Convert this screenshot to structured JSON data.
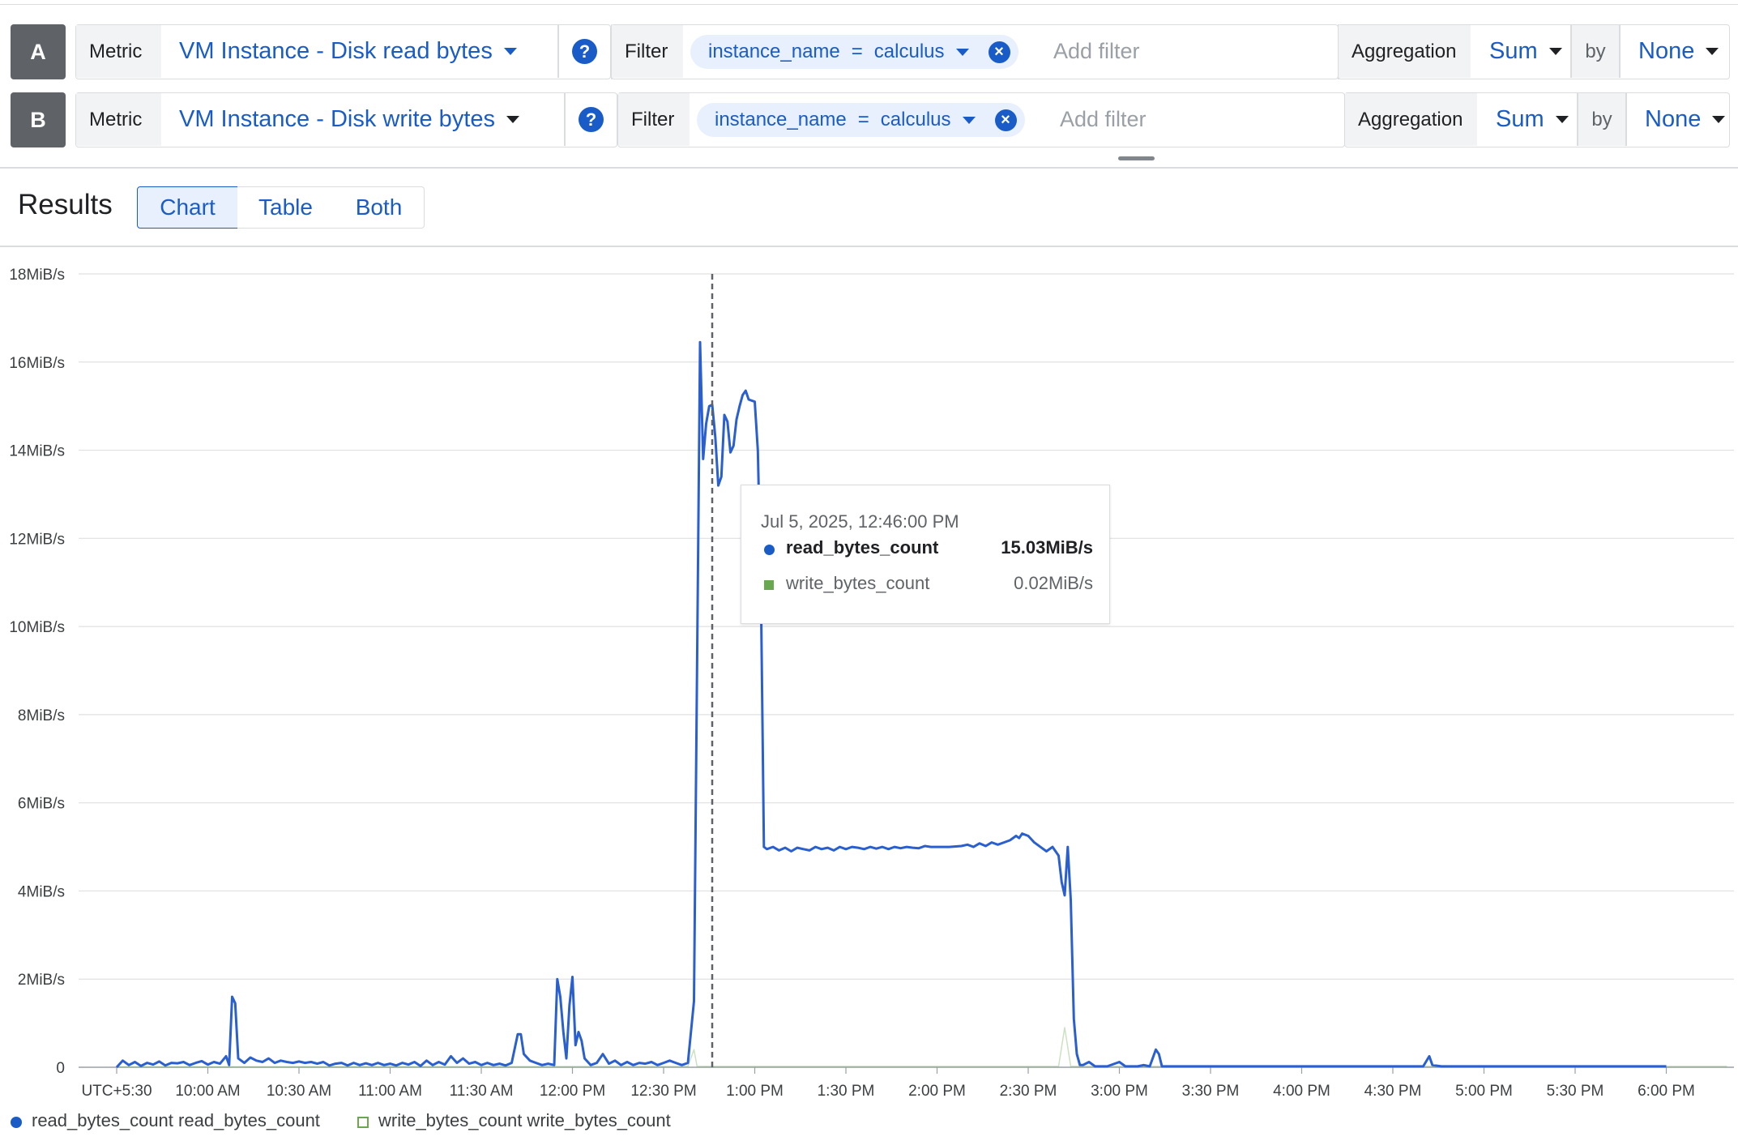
{
  "queries": [
    {
      "letter": "A",
      "metric_label": "Metric",
      "metric_value": "VM Instance - Disk read bytes",
      "help_icon": "?",
      "filter_label": "Filter",
      "filter_key": "instance_name",
      "filter_op": "=",
      "filter_value": "calculus",
      "filter_remove": "×",
      "add_filter_placeholder": "Add filter",
      "aggregation_label": "Aggregation",
      "aggregation_value": "Sum",
      "by_label": "by",
      "group_value": "None"
    },
    {
      "letter": "B",
      "metric_label": "Metric",
      "metric_value": "VM Instance - Disk write bytes",
      "help_icon": "?",
      "filter_label": "Filter",
      "filter_key": "instance_name",
      "filter_op": "=",
      "filter_value": "calculus",
      "filter_remove": "×",
      "add_filter_placeholder": "Add filter",
      "aggregation_label": "Aggregation",
      "aggregation_value": "Sum",
      "by_label": "by",
      "group_value": "None"
    }
  ],
  "results": {
    "title": "Results",
    "view_tabs": [
      "Chart",
      "Table",
      "Both"
    ],
    "active_tab": "Chart"
  },
  "tooltip": {
    "date": "Jul 5, 2025, 12:46:00 PM",
    "rows": [
      {
        "name": "read_bytes_count",
        "value": "15.03MiB/s"
      },
      {
        "name": "write_bytes_count",
        "value": "0.02MiB/s"
      }
    ]
  },
  "legend": [
    {
      "label": "read_bytes_count read_bytes_count"
    },
    {
      "label": "write_bytes_count write_bytes_count"
    }
  ],
  "colors": {
    "accent": "#1a5cc7",
    "read_series": "#2a5fcf",
    "write_series": "#6aa84f",
    "gridline": "#e0e0e0"
  },
  "chart_data": {
    "type": "line",
    "y_unit": "MiB/s",
    "ylim": [
      0,
      18
    ],
    "y_ticks": [
      "0",
      "2MiB/s",
      "4MiB/s",
      "6MiB/s",
      "8MiB/s",
      "10MiB/s",
      "12MiB/s",
      "14MiB/s",
      "16MiB/s",
      "18MiB/s"
    ],
    "x_ticks": [
      "UTC+5:30",
      "10:00 AM",
      "10:30 AM",
      "11:00 AM",
      "11:30 AM",
      "12:00 PM",
      "12:30 PM",
      "1:00 PM",
      "1:30 PM",
      "2:00 PM",
      "2:30 PM",
      "3:00 PM",
      "3:30 PM",
      "4:00 PM",
      "4:30 PM",
      "5:00 PM",
      "5:30 PM",
      "6:00 PM"
    ],
    "x_range": [
      "09:30",
      "18:20"
    ],
    "grid": true,
    "cursor_time": "12:46",
    "series": [
      {
        "name": "read_bytes_count",
        "points": [
          [
            "09:30",
            0.0
          ],
          [
            "09:32",
            0.15
          ],
          [
            "09:34",
            0.05
          ],
          [
            "09:36",
            0.12
          ],
          [
            "09:38",
            0.03
          ],
          [
            "09:40",
            0.1
          ],
          [
            "09:42",
            0.06
          ],
          [
            "09:44",
            0.13
          ],
          [
            "09:46",
            0.04
          ],
          [
            "09:48",
            0.1
          ],
          [
            "09:50",
            0.09
          ],
          [
            "09:52",
            0.12
          ],
          [
            "09:54",
            0.05
          ],
          [
            "09:56",
            0.1
          ],
          [
            "09:58",
            0.14
          ],
          [
            "10:00",
            0.06
          ],
          [
            "10:02",
            0.12
          ],
          [
            "10:04",
            0.08
          ],
          [
            "10:06",
            0.25
          ],
          [
            "10:07",
            0.05
          ],
          [
            "10:08",
            1.6
          ],
          [
            "10:09",
            1.45
          ],
          [
            "10:10",
            0.2
          ],
          [
            "10:12",
            0.1
          ],
          [
            "10:14",
            0.22
          ],
          [
            "10:16",
            0.15
          ],
          [
            "10:18",
            0.12
          ],
          [
            "10:20",
            0.2
          ],
          [
            "10:22",
            0.1
          ],
          [
            "10:24",
            0.15
          ],
          [
            "10:26",
            0.12
          ],
          [
            "10:28",
            0.1
          ],
          [
            "10:30",
            0.13
          ],
          [
            "10:32",
            0.1
          ],
          [
            "10:34",
            0.12
          ],
          [
            "10:36",
            0.08
          ],
          [
            "10:38",
            0.12
          ],
          [
            "10:40",
            0.04
          ],
          [
            "10:42",
            0.08
          ],
          [
            "10:44",
            0.1
          ],
          [
            "10:46",
            0.04
          ],
          [
            "10:48",
            0.1
          ],
          [
            "10:50",
            0.05
          ],
          [
            "10:52",
            0.09
          ],
          [
            "10:54",
            0.05
          ],
          [
            "10:56",
            0.1
          ],
          [
            "10:58",
            0.05
          ],
          [
            "11:00",
            0.08
          ],
          [
            "11:02",
            0.04
          ],
          [
            "11:04",
            0.1
          ],
          [
            "11:06",
            0.06
          ],
          [
            "11:08",
            0.12
          ],
          [
            "11:10",
            0.03
          ],
          [
            "11:12",
            0.15
          ],
          [
            "11:14",
            0.05
          ],
          [
            "11:16",
            0.12
          ],
          [
            "11:18",
            0.06
          ],
          [
            "11:20",
            0.25
          ],
          [
            "11:22",
            0.1
          ],
          [
            "11:24",
            0.2
          ],
          [
            "11:26",
            0.08
          ],
          [
            "11:28",
            0.12
          ],
          [
            "11:30",
            0.05
          ],
          [
            "11:32",
            0.1
          ],
          [
            "11:34",
            0.05
          ],
          [
            "11:36",
            0.08
          ],
          [
            "11:38",
            0.04
          ],
          [
            "11:40",
            0.1
          ],
          [
            "11:42",
            0.75
          ],
          [
            "11:43",
            0.75
          ],
          [
            "11:44",
            0.3
          ],
          [
            "11:46",
            0.15
          ],
          [
            "11:48",
            0.1
          ],
          [
            "11:50",
            0.05
          ],
          [
            "11:52",
            0.08
          ],
          [
            "11:54",
            0.05
          ],
          [
            "11:55",
            2.0
          ],
          [
            "11:56",
            1.6
          ],
          [
            "11:57",
            0.8
          ],
          [
            "11:58",
            0.2
          ],
          [
            "11:59",
            1.4
          ],
          [
            "12:00",
            2.05
          ],
          [
            "12:01",
            0.5
          ],
          [
            "12:02",
            0.8
          ],
          [
            "12:03",
            0.6
          ],
          [
            "12:04",
            0.2
          ],
          [
            "12:06",
            0.05
          ],
          [
            "12:08",
            0.1
          ],
          [
            "12:10",
            0.3
          ],
          [
            "12:12",
            0.08
          ],
          [
            "12:14",
            0.15
          ],
          [
            "12:16",
            0.05
          ],
          [
            "12:18",
            0.12
          ],
          [
            "12:20",
            0.05
          ],
          [
            "12:22",
            0.1
          ],
          [
            "12:24",
            0.08
          ],
          [
            "12:26",
            0.12
          ],
          [
            "12:28",
            0.05
          ],
          [
            "12:30",
            0.1
          ],
          [
            "12:32",
            0.15
          ],
          [
            "12:34",
            0.1
          ],
          [
            "12:36",
            0.05
          ],
          [
            "12:38",
            0.1
          ],
          [
            "12:40",
            1.5
          ],
          [
            "12:42",
            16.45
          ],
          [
            "12:43",
            13.8
          ],
          [
            "12:44",
            14.6
          ],
          [
            "12:45",
            15.0
          ],
          [
            "12:46",
            15.03
          ],
          [
            "12:47",
            14.3
          ],
          [
            "12:48",
            13.2
          ],
          [
            "12:49",
            13.4
          ],
          [
            "12:50",
            14.8
          ],
          [
            "12:51",
            14.65
          ],
          [
            "12:52",
            13.95
          ],
          [
            "12:53",
            14.1
          ],
          [
            "12:54",
            14.7
          ],
          [
            "12:55",
            15.0
          ],
          [
            "12:56",
            15.25
          ],
          [
            "12:57",
            15.35
          ],
          [
            "12:58",
            15.15
          ],
          [
            "13:00",
            15.1
          ],
          [
            "13:01",
            14.0
          ],
          [
            "13:02",
            11.0
          ],
          [
            "13:03",
            5.0
          ],
          [
            "13:04",
            4.95
          ],
          [
            "13:06",
            5.0
          ],
          [
            "13:08",
            4.92
          ],
          [
            "13:10",
            4.98
          ],
          [
            "13:12",
            4.9
          ],
          [
            "13:14",
            4.98
          ],
          [
            "13:16",
            4.95
          ],
          [
            "13:18",
            4.92
          ],
          [
            "13:20",
            5.0
          ],
          [
            "13:22",
            4.95
          ],
          [
            "13:24",
            4.98
          ],
          [
            "13:26",
            4.92
          ],
          [
            "13:28",
            5.0
          ],
          [
            "13:30",
            4.95
          ],
          [
            "13:32",
            5.0
          ],
          [
            "13:34",
            4.98
          ],
          [
            "13:36",
            4.95
          ],
          [
            "13:38",
            5.0
          ],
          [
            "13:40",
            4.96
          ],
          [
            "13:42",
            5.0
          ],
          [
            "13:44",
            4.95
          ],
          [
            "13:46",
            5.0
          ],
          [
            "13:48",
            4.97
          ],
          [
            "13:50",
            5.0
          ],
          [
            "13:52",
            4.98
          ],
          [
            "13:54",
            4.97
          ],
          [
            "13:56",
            5.02
          ],
          [
            "13:58",
            5.0
          ],
          [
            "14:00",
            5.0
          ],
          [
            "14:04",
            5.0
          ],
          [
            "14:08",
            5.02
          ],
          [
            "14:10",
            5.05
          ],
          [
            "14:12",
            5.0
          ],
          [
            "14:14",
            5.08
          ],
          [
            "14:16",
            5.02
          ],
          [
            "14:18",
            5.1
          ],
          [
            "14:20",
            5.05
          ],
          [
            "14:22",
            5.1
          ],
          [
            "14:24",
            5.15
          ],
          [
            "14:26",
            5.25
          ],
          [
            "14:27",
            5.2
          ],
          [
            "14:28",
            5.3
          ],
          [
            "14:30",
            5.25
          ],
          [
            "14:32",
            5.1
          ],
          [
            "14:34",
            5.0
          ],
          [
            "14:36",
            4.9
          ],
          [
            "14:38",
            5.0
          ],
          [
            "14:40",
            4.8
          ],
          [
            "14:41",
            4.2
          ],
          [
            "14:42",
            3.9
          ],
          [
            "14:43",
            5.0
          ],
          [
            "14:44",
            3.8
          ],
          [
            "14:45",
            1.1
          ],
          [
            "14:46",
            0.3
          ],
          [
            "14:47",
            0.05
          ],
          [
            "14:48",
            0.05
          ],
          [
            "14:50",
            0.12
          ],
          [
            "14:52",
            0.02
          ],
          [
            "14:56",
            0.02
          ],
          [
            "15:00",
            0.12
          ],
          [
            "15:02",
            0.02
          ],
          [
            "15:06",
            0.02
          ],
          [
            "15:08",
            0.05
          ],
          [
            "15:10",
            0.02
          ],
          [
            "15:12",
            0.4
          ],
          [
            "15:13",
            0.3
          ],
          [
            "15:14",
            0.02
          ],
          [
            "15:30",
            0.02
          ],
          [
            "16:00",
            0.02
          ],
          [
            "16:30",
            0.02
          ],
          [
            "16:40",
            0.02
          ],
          [
            "16:42",
            0.25
          ],
          [
            "16:43",
            0.05
          ],
          [
            "16:46",
            0.02
          ],
          [
            "17:00",
            0.02
          ],
          [
            "17:30",
            0.02
          ],
          [
            "18:00",
            0.02
          ]
        ]
      },
      {
        "name": "write_bytes_count",
        "points": [
          [
            "09:30",
            0.01
          ],
          [
            "12:38",
            0.02
          ],
          [
            "12:40",
            0.4
          ],
          [
            "12:41",
            0.02
          ],
          [
            "12:46",
            0.02
          ],
          [
            "14:40",
            0.02
          ],
          [
            "14:42",
            0.9
          ],
          [
            "14:44",
            0.02
          ],
          [
            "18:20",
            0.02
          ]
        ]
      }
    ]
  }
}
